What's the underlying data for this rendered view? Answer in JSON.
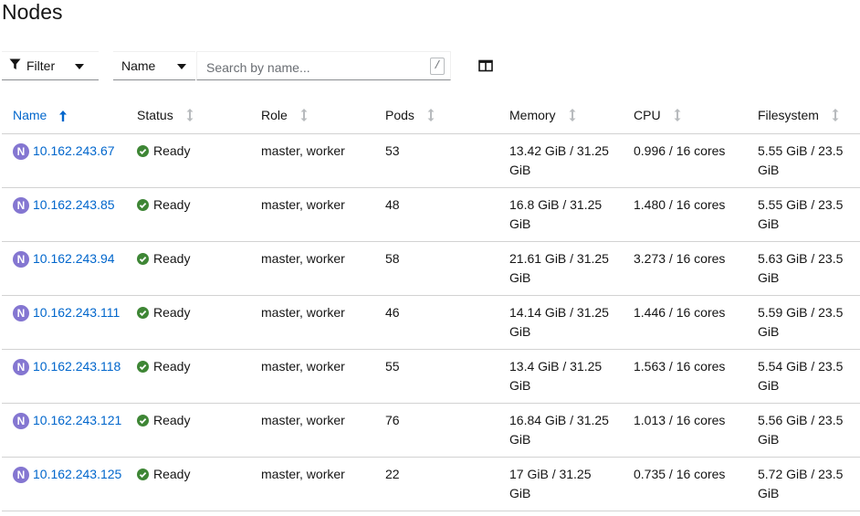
{
  "page": {
    "title": "Nodes"
  },
  "toolbar": {
    "filter_label": "Filter",
    "search_by_label": "Name",
    "search_placeholder": "Search by name...",
    "search_value": "",
    "shortcut_hint": "/"
  },
  "table": {
    "headers": [
      "Name",
      "Status",
      "Role",
      "Pods",
      "Memory",
      "CPU",
      "Filesystem"
    ],
    "sorted_column": "Name",
    "sort_direction": "ascending",
    "badge_letter": "N",
    "rows": [
      {
        "name": "10.162.243.67",
        "status": "Ready",
        "role": "master, worker",
        "pods": "53",
        "memory": "13.42 GiB / 31.25 GiB",
        "cpu": "0.996 / 16 cores",
        "filesystem": "5.55 GiB / 23.5 GiB"
      },
      {
        "name": "10.162.243.85",
        "status": "Ready",
        "role": "master, worker",
        "pods": "48",
        "memory": "16.8 GiB / 31.25 GiB",
        "cpu": "1.480 / 16 cores",
        "filesystem": "5.55 GiB / 23.5 GiB"
      },
      {
        "name": "10.162.243.94",
        "status": "Ready",
        "role": "master, worker",
        "pods": "58",
        "memory": "21.61 GiB / 31.25 GiB",
        "cpu": "3.273 / 16 cores",
        "filesystem": "5.63 GiB / 23.5 GiB"
      },
      {
        "name": "10.162.243.111",
        "status": "Ready",
        "role": "master, worker",
        "pods": "46",
        "memory": "14.14 GiB / 31.25 GiB",
        "cpu": "1.446 / 16 cores",
        "filesystem": "5.59 GiB / 23.5 GiB"
      },
      {
        "name": "10.162.243.118",
        "status": "Ready",
        "role": "master, worker",
        "pods": "55",
        "memory": "13.4 GiB / 31.25 GiB",
        "cpu": "1.563 / 16 cores",
        "filesystem": "5.54 GiB / 23.5 GiB"
      },
      {
        "name": "10.162.243.121",
        "status": "Ready",
        "role": "master, worker",
        "pods": "76",
        "memory": "16.84 GiB / 31.25 GiB",
        "cpu": "1.013 / 16 cores",
        "filesystem": "5.56 GiB / 23.5 GiB"
      },
      {
        "name": "10.162.243.125",
        "status": "Ready",
        "role": "master, worker",
        "pods": "22",
        "memory": "17 GiB / 31.25 GiB",
        "cpu": "0.735 / 16 cores",
        "filesystem": "5.72 GiB / 23.5 GiB"
      }
    ]
  },
  "colors": {
    "link": "#0066cc",
    "node_badge": "#8476d1",
    "status_ok": "#3e8635",
    "border": "#d2d2d2"
  },
  "icons": {
    "filter": "filter-icon",
    "caret": "caret-down-icon",
    "columns": "columns-icon",
    "sort_active": "sort-up-arrow-icon",
    "sort_inactive": "sort-icon",
    "status_ready": "check-circle-icon"
  }
}
